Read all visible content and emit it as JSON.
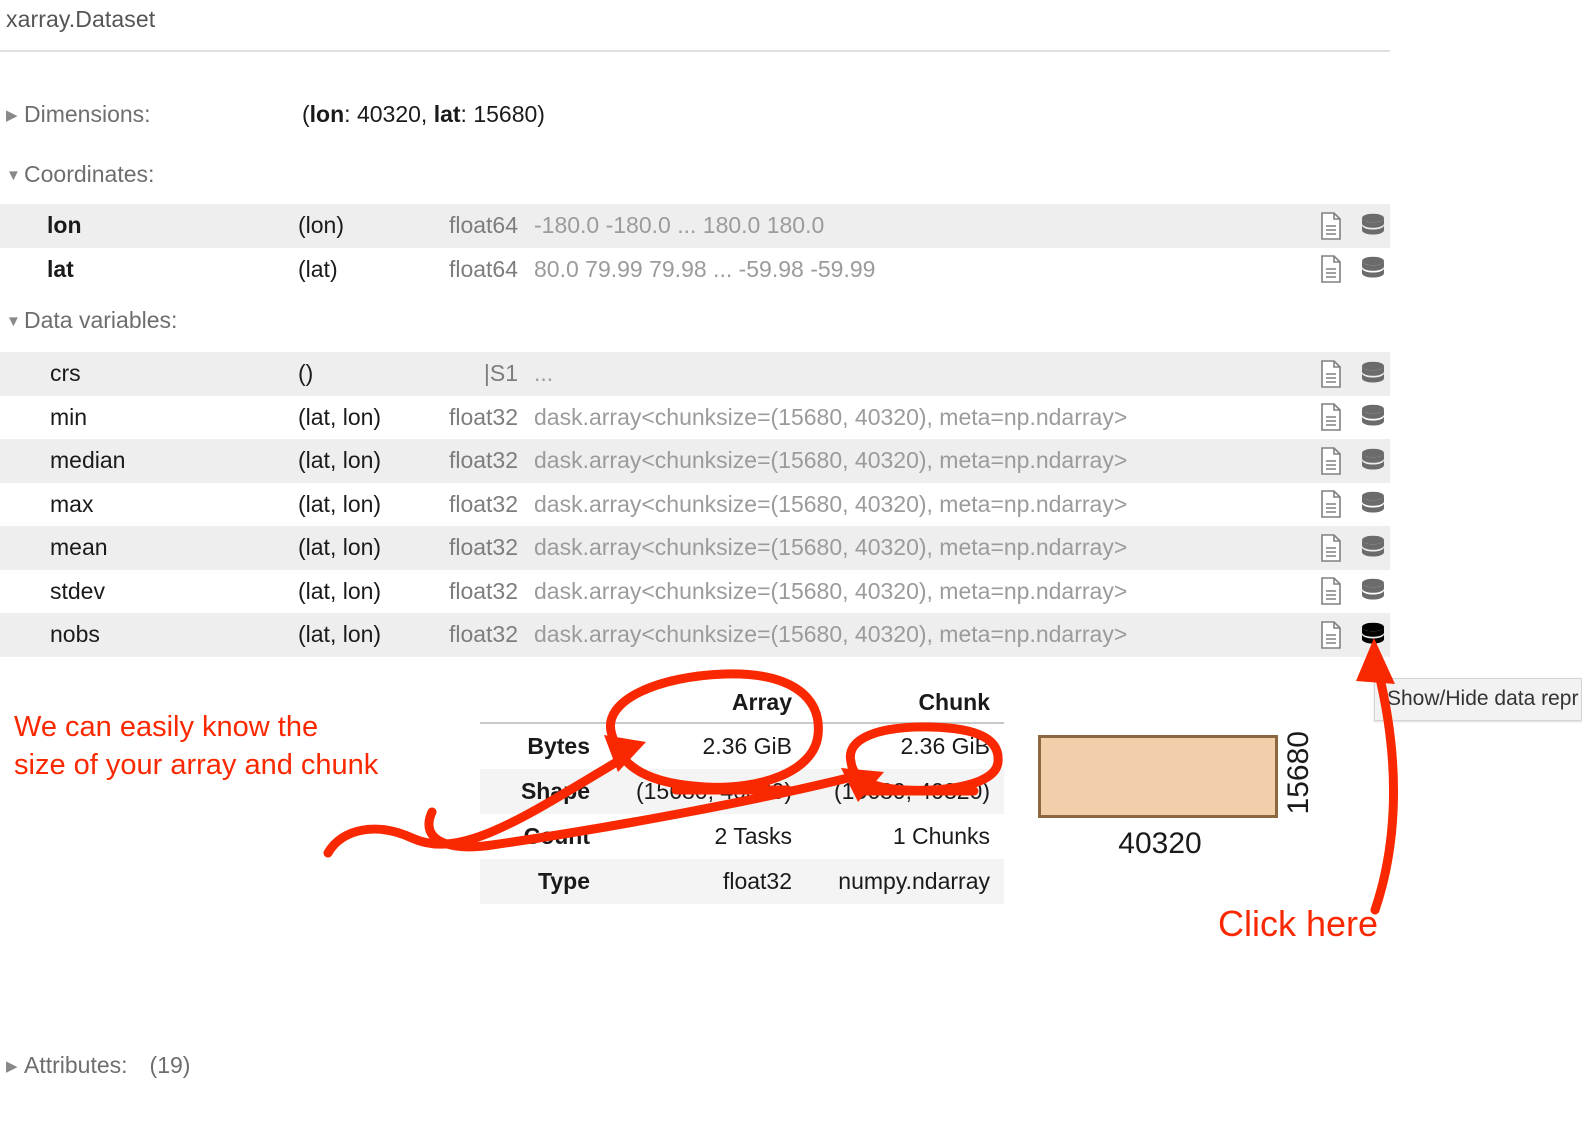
{
  "repr": {
    "title": "xarray.Dataset",
    "sections": {
      "dimensions": {
        "triangle": "▶",
        "label": "Dimensions:",
        "value_prefix": "(",
        "dim1_name": "lon",
        "dim1_size": ": 40320, ",
        "dim2_name": "lat",
        "dim2_size": ": 15680)"
      },
      "coordinates": {
        "triangle": "▼",
        "label": "Coordinates:"
      },
      "data_variables": {
        "triangle": "▼",
        "label": "Data variables:"
      },
      "attributes": {
        "triangle": "▶",
        "label": "Attributes:",
        "count": "(19)"
      }
    },
    "coordinate_rows": [
      {
        "name": "lon",
        "dims": "(lon)",
        "dtype": "float64",
        "preview": "-180.0 -180.0 ... 180.0 180.0",
        "attrs_icon": "file-text-icon",
        "data_icon": "database-icon"
      },
      {
        "name": "lat",
        "dims": "(lat)",
        "dtype": "float64",
        "preview": "80.0 79.99 79.98 ... -59.98 -59.99",
        "attrs_icon": "file-text-icon",
        "data_icon": "database-icon"
      }
    ],
    "data_variable_rows": [
      {
        "name": "crs",
        "dims": "()",
        "dtype": "|S1",
        "preview": "...",
        "attrs_icon": "file-text-icon",
        "data_icon": "database-icon",
        "data_icon_active": false
      },
      {
        "name": "min",
        "dims": "(lat, lon)",
        "dtype": "float32",
        "preview": "dask.array<chunksize=(15680, 40320), meta=np.ndarray>",
        "attrs_icon": "file-text-icon",
        "data_icon": "database-icon",
        "data_icon_active": false
      },
      {
        "name": "median",
        "dims": "(lat, lon)",
        "dtype": "float32",
        "preview": "dask.array<chunksize=(15680, 40320), meta=np.ndarray>",
        "attrs_icon": "file-text-icon",
        "data_icon": "database-icon",
        "data_icon_active": false
      },
      {
        "name": "max",
        "dims": "(lat, lon)",
        "dtype": "float32",
        "preview": "dask.array<chunksize=(15680, 40320), meta=np.ndarray>",
        "attrs_icon": "file-text-icon",
        "data_icon": "database-icon",
        "data_icon_active": false
      },
      {
        "name": "mean",
        "dims": "(lat, lon)",
        "dtype": "float32",
        "preview": "dask.array<chunksize=(15680, 40320), meta=np.ndarray>",
        "attrs_icon": "file-text-icon",
        "data_icon": "database-icon",
        "data_icon_active": false
      },
      {
        "name": "stdev",
        "dims": "(lat, lon)",
        "dtype": "float32",
        "preview": "dask.array<chunksize=(15680, 40320), meta=np.ndarray>",
        "attrs_icon": "file-text-icon",
        "data_icon": "database-icon",
        "data_icon_active": false
      },
      {
        "name": "nobs",
        "dims": "(lat, lon)",
        "dtype": "float32",
        "preview": "dask.array<chunksize=(15680, 40320), meta=np.ndarray>",
        "attrs_icon": "file-text-icon",
        "data_icon": "database-icon",
        "data_icon_active": true
      }
    ]
  },
  "dask_info": {
    "headers": {
      "row_label": "",
      "array": "Array",
      "chunk": "Chunk"
    },
    "rows": [
      {
        "label": "Bytes",
        "array": "2.36 GiB",
        "chunk": "2.36 GiB"
      },
      {
        "label": "Shape",
        "array": "(15680, 40320)",
        "chunk": "(15680, 40320)"
      },
      {
        "label": "Count",
        "array": "2 Tasks",
        "chunk": "1 Chunks"
      },
      {
        "label": "Type",
        "array": "float32",
        "chunk": "numpy.ndarray"
      }
    ],
    "diagram": {
      "width_label": "40320",
      "height_label": "15680",
      "fill_color": "#f2ceab",
      "stroke_color": "#8b6840"
    }
  },
  "tooltip": {
    "text": "Show/Hide data repr"
  },
  "annotations": {
    "color": "#fa2800",
    "size_note": "We can easily know the\nsize of your array and chunk",
    "click_here": "Click here"
  }
}
